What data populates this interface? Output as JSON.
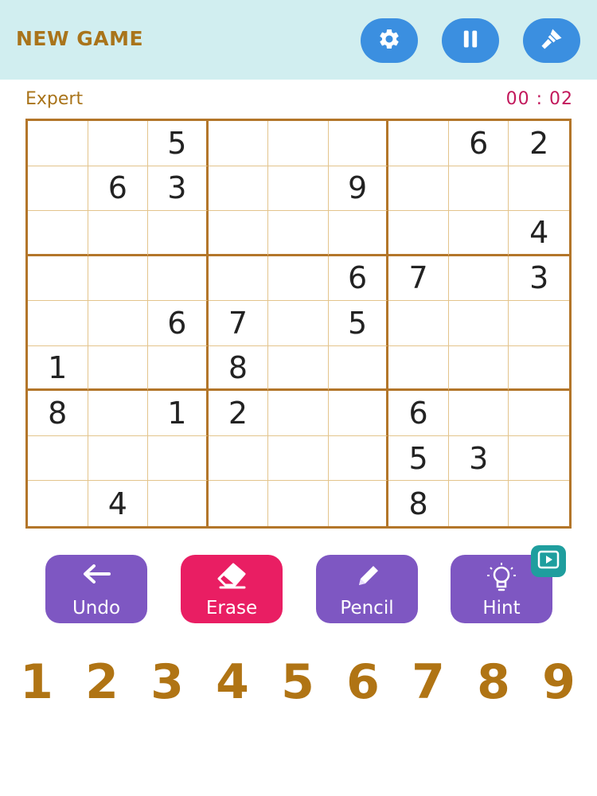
{
  "header": {
    "new_game_label": "NEW GAME",
    "buttons": [
      "gear-icon",
      "pause-icon",
      "paint-brush-icon"
    ],
    "accent_color": "#3b8fe0"
  },
  "status": {
    "difficulty": "Expert",
    "timer": "00 : 02"
  },
  "board": {
    "grid": [
      [
        "",
        "",
        "5",
        "",
        "",
        "",
        "",
        "6",
        "2"
      ],
      [
        "",
        "6",
        "3",
        "",
        "",
        "9",
        "",
        "",
        ""
      ],
      [
        "",
        "",
        "",
        "",
        "",
        "",
        "",
        "",
        "4"
      ],
      [
        "",
        "",
        "",
        "",
        "",
        "6",
        "7",
        "",
        "3"
      ],
      [
        "",
        "",
        "6",
        "7",
        "",
        "5",
        "",
        "",
        ""
      ],
      [
        "1",
        "",
        "",
        "8",
        "",
        "",
        "",
        "",
        ""
      ],
      [
        "8",
        "",
        "1",
        "2",
        "",
        "",
        "6",
        "",
        ""
      ],
      [
        "",
        "",
        "",
        "",
        "",
        "",
        "5",
        "3",
        ""
      ],
      [
        "",
        "4",
        "",
        "",
        "",
        "",
        "8",
        "",
        ""
      ]
    ]
  },
  "tools": {
    "undo": "Undo",
    "erase": "Erase",
    "pencil": "Pencil",
    "hint": "Hint",
    "hint_badge": "video-play-icon"
  },
  "numpad": [
    "1",
    "2",
    "3",
    "4",
    "5",
    "6",
    "7",
    "8",
    "9"
  ]
}
